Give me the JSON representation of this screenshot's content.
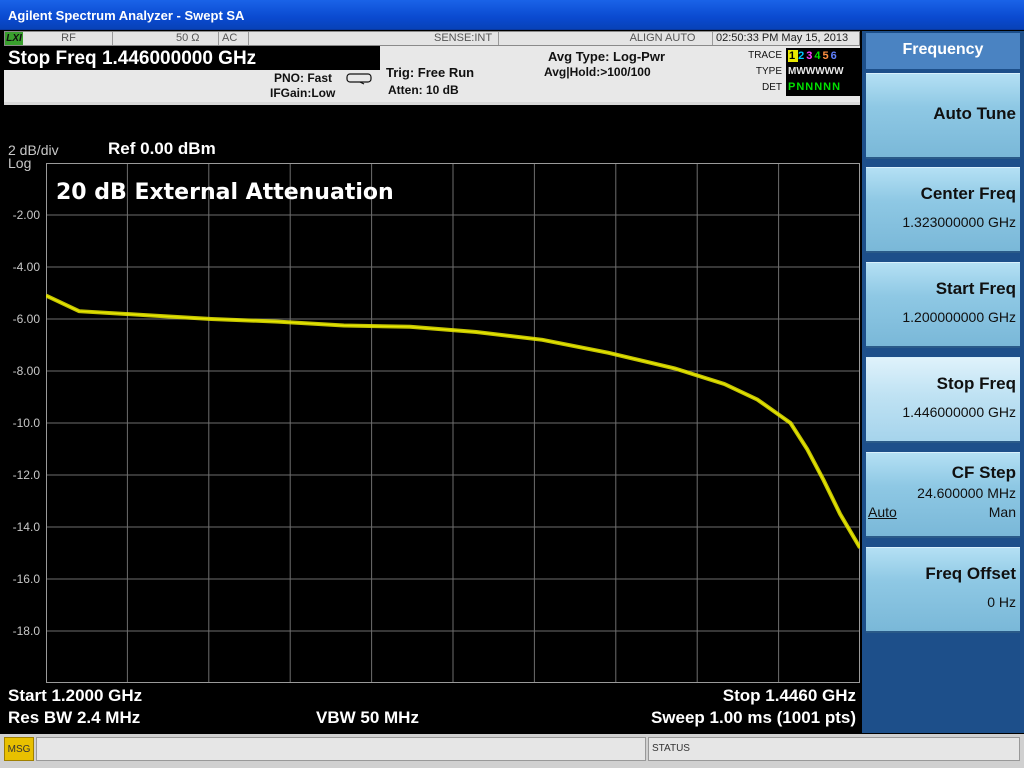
{
  "window": {
    "title": "Agilent Spectrum Analyzer - Swept SA"
  },
  "statusbar": {
    "lxi": "LXI",
    "rf": "RF",
    "impedance": "50 Ω",
    "coupling": "AC",
    "sense": "SENSE:INT",
    "align": "ALIGN AUTO",
    "datetime": "02:50:33 PM May 15, 2013"
  },
  "header": {
    "stop_freq": "Stop Freq  1.446000000 GHz",
    "pno": "PNO: Fast",
    "ifgain": "IFGain:Low",
    "trig": "Trig: Free Run",
    "atten": "Atten: 10 dB",
    "avg_type": "Avg Type: Log-Pwr",
    "avg_hold": "Avg|Hold:>100/100",
    "trace_label": "TRACE",
    "type_label": "TYPE",
    "det_label": "DET",
    "trace_nums": [
      "1",
      "2",
      "3",
      "4",
      "5",
      "6"
    ],
    "type_row": "MWWWWW",
    "det_row": "PNNNNN"
  },
  "plot": {
    "scale": "2 dB/div",
    "log": "Log",
    "ref": "Ref 0.00 dBm",
    "annotation": "20 dB External Attenuation",
    "y_ticks": [
      "-2.00",
      "-4.00",
      "-6.00",
      "-8.00",
      "-10.0",
      "-12.0",
      "-14.0",
      "-16.0",
      "-18.0"
    ],
    "start": "Start 1.2000 GHz",
    "stop": "Stop 1.4460 GHz",
    "res_bw": "Res BW 2.4 MHz",
    "vbw": "VBW 50 MHz",
    "sweep": "Sweep  1.00 ms (1001 pts)",
    "trace_color": "#e8e800",
    "grid_color": "#6e6e6e"
  },
  "chart_data": {
    "type": "line",
    "x_start": 1.2,
    "x_stop": 1.446,
    "ylim": [
      -20,
      0
    ],
    "x": [
      1.2,
      1.21,
      1.23,
      1.25,
      1.27,
      1.29,
      1.31,
      1.33,
      1.35,
      1.37,
      1.39,
      1.405,
      1.415,
      1.425,
      1.43,
      1.435,
      1.44,
      1.446
    ],
    "y": [
      -5.1,
      -5.7,
      -5.85,
      -6.0,
      -6.1,
      -6.25,
      -6.3,
      -6.5,
      -6.8,
      -7.3,
      -7.9,
      -8.5,
      -9.1,
      -10.0,
      -11.0,
      -12.2,
      -13.5,
      -14.8
    ]
  },
  "softkeys": {
    "title": "Frequency",
    "auto_tune": "Auto Tune",
    "center_freq": "Center Freq",
    "center_value": "1.323000000 GHz",
    "start_freq": "Start Freq",
    "start_value": "1.200000000 GHz",
    "stop_freq": "Stop Freq",
    "stop_value": "1.446000000 GHz",
    "cf_step": "CF Step",
    "cf_step_value": "24.600000 MHz",
    "auto": "Auto",
    "man": "Man",
    "freq_offset": "Freq Offset",
    "freq_offset_value": "0 Hz"
  },
  "msgbar": {
    "msg": "MSG",
    "status": "STATUS"
  }
}
